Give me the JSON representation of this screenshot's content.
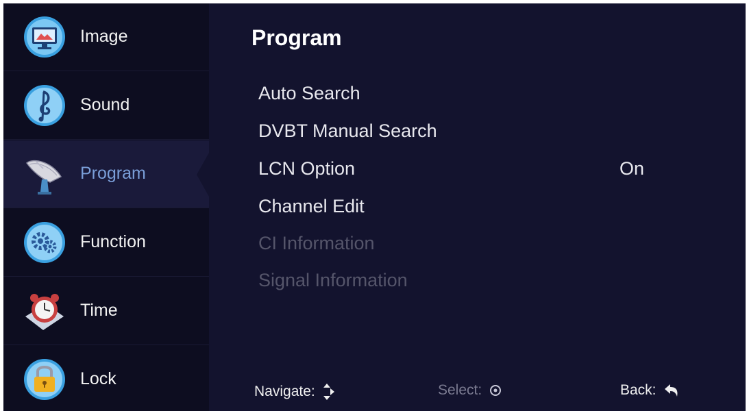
{
  "sidebar": {
    "items": [
      {
        "label": "Image",
        "icon": "monitor-icon"
      },
      {
        "label": "Sound",
        "icon": "music-note-icon"
      },
      {
        "label": "Program",
        "icon": "satellite-dish-icon",
        "active": true
      },
      {
        "label": "Function",
        "icon": "gear-icon"
      },
      {
        "label": "Time",
        "icon": "alarm-clock-icon"
      },
      {
        "label": "Lock",
        "icon": "padlock-icon"
      }
    ]
  },
  "main": {
    "title": "Program",
    "menu": [
      {
        "label": "Auto Search"
      },
      {
        "label": "DVBT Manual Search"
      },
      {
        "label": "LCN Option",
        "value": "On"
      },
      {
        "label": "Channel Edit"
      },
      {
        "label": "CI Information",
        "disabled": true
      },
      {
        "label": "Signal Information",
        "disabled": true
      }
    ]
  },
  "footer": {
    "navigate_label": "Navigate:",
    "select_label": "Select:",
    "back_label": "Back:"
  },
  "colors": {
    "background": "#13132e",
    "sidebar": "#0d0d20",
    "active_label": "#7a9ed8",
    "disabled_text": "#55556a"
  }
}
